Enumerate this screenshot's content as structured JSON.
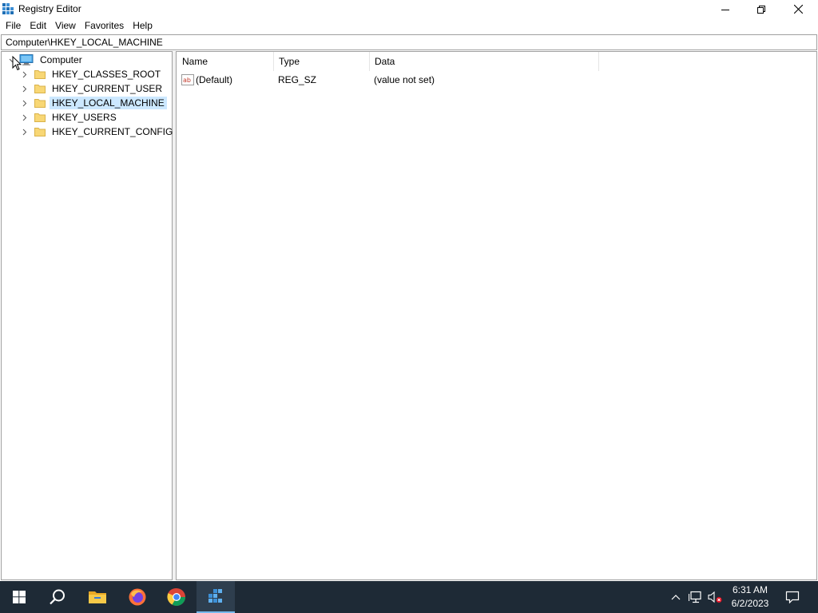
{
  "window": {
    "title": "Registry Editor"
  },
  "menu": [
    "File",
    "Edit",
    "View",
    "Favorites",
    "Help"
  ],
  "address": {
    "path": "Computer\\HKEY_LOCAL_MACHINE"
  },
  "tree": {
    "root": "Computer",
    "items": [
      {
        "label": "HKEY_CLASSES_ROOT",
        "selected": false
      },
      {
        "label": "HKEY_CURRENT_USER",
        "selected": false
      },
      {
        "label": "HKEY_LOCAL_MACHINE",
        "selected": true
      },
      {
        "label": "HKEY_USERS",
        "selected": false
      },
      {
        "label": "HKEY_CURRENT_CONFIG",
        "selected": false
      }
    ]
  },
  "list": {
    "headers": {
      "name": "Name",
      "type": "Type",
      "data": "Data"
    },
    "rows": [
      {
        "name": "(Default)",
        "type": "REG_SZ",
        "data": "(value not set)",
        "icon": "string-value-icon"
      }
    ]
  },
  "taskbar": {
    "apps": [
      "start-icon",
      "search-icon",
      "file-explorer-icon",
      "firefox-icon",
      "chrome-icon",
      "registry-editor-icon"
    ],
    "active_app": "registry-editor-icon",
    "tray_icons": [
      "chevron-up-icon",
      "network-icon",
      "volume-muted-icon",
      "notification-icon"
    ],
    "time": "6:31 AM",
    "date": "6/2/2023"
  },
  "colors": {
    "selection": "#cce8ff",
    "taskbar": "#1e2a36",
    "active_indicator": "#76b9ed"
  }
}
